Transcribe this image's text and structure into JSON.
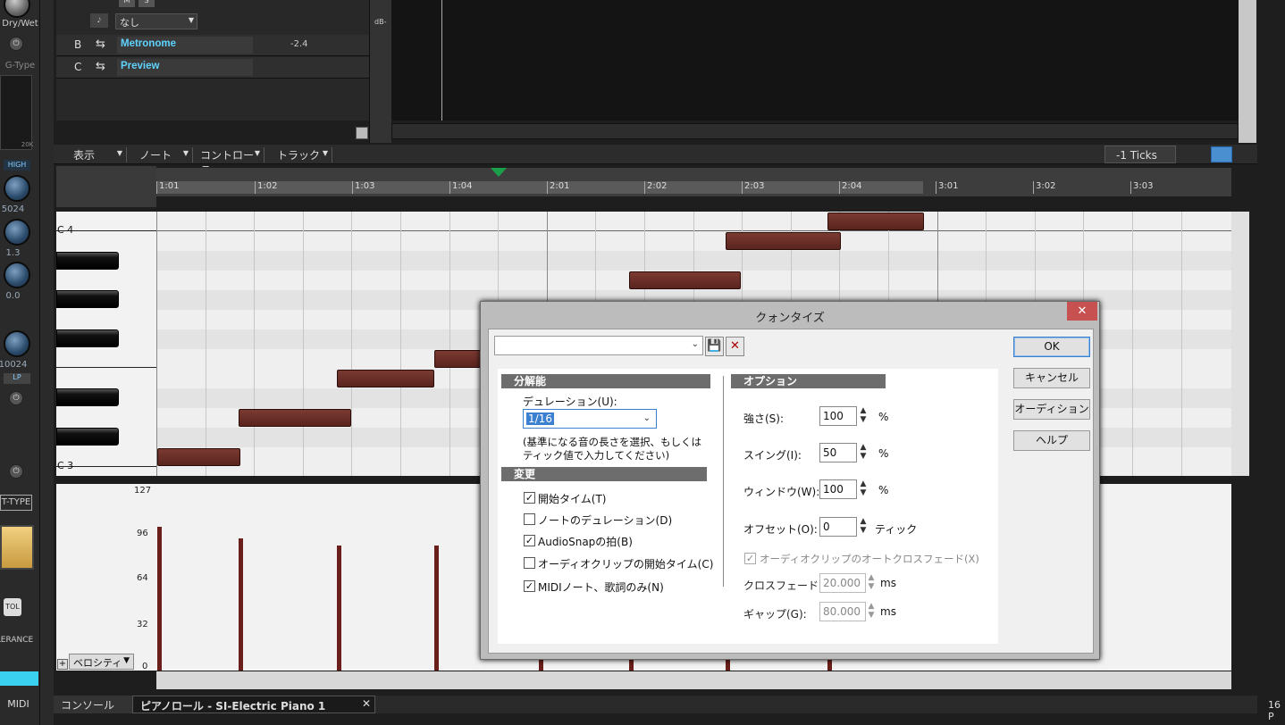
{
  "left_strip": {
    "drywet": "Dry/Wet",
    "gtype": "G-Type",
    "k20": "20K",
    "high": "HIGH",
    "freq": "5024",
    "gain": "1.3",
    "q": "0.0",
    "freq2": "10024",
    "lp": "LP",
    "ttype": "T-TYPE",
    "tol": "TOL",
    "tolerance": "LERANCE",
    "midi": "MIDI"
  },
  "tracks": {
    "none_label": "なし",
    "db_label": "dB-",
    "rows": [
      {
        "letter": "B",
        "name": "Metronome",
        "value": "-2.4"
      },
      {
        "letter": "C",
        "name": "Preview",
        "value": ""
      }
    ]
  },
  "menubar": {
    "view": "表示",
    "note": "ノート",
    "controller": "コントローラ",
    "track": "トラック",
    "ticks": "-1 Ticks"
  },
  "ruler": {
    "ticks": [
      "1:01",
      "1:02",
      "1:03",
      "1:04",
      "2:01",
      "2:02",
      "2:03",
      "2:04",
      "3:01",
      "3:02",
      "3:03"
    ]
  },
  "piano": {
    "c4": "C 4",
    "c3": "C 3"
  },
  "velocity": {
    "labels": [
      "127",
      "96",
      "64",
      "32",
      "0"
    ],
    "dropdown": "ベロシティ"
  },
  "tabs": {
    "console": "コンソール",
    "pianoroll": "ピアノロール - SI-Electric Piano 1",
    "right_num": "16 P"
  },
  "dialog": {
    "title": "クォンタイズ",
    "preset_value": "",
    "resolution_header": "分解能",
    "duration_label": "デュレーション(U):",
    "duration_value": "1/16",
    "duration_help1": "(基準になる音の長さを選択、もしくは",
    "duration_help2": "ティック値で入力してください)",
    "change_header": "変更",
    "checks": [
      {
        "label": "開始タイム(T)",
        "checked": true
      },
      {
        "label": "ノートのデュレーション(D)",
        "checked": false
      },
      {
        "label": "AudioSnapの拍(B)",
        "checked": true
      },
      {
        "label": "オーディオクリップの開始タイム(C)",
        "checked": false
      },
      {
        "label": "MIDIノート、歌詞のみ(N)",
        "checked": true
      }
    ],
    "options_header": "オプション",
    "strength_label": "強さ(S):",
    "strength_value": "100",
    "strength_unit": "%",
    "swing_label": "スイング(I):",
    "swing_value": "50",
    "swing_unit": "%",
    "window_label": "ウィンドウ(W):",
    "window_value": "100",
    "window_unit": "%",
    "offset_label": "オフセット(O):",
    "offset_value": "0",
    "offset_unit": "ティック",
    "autocross_label": "オーディオクリップのオートクロスフェード(X)",
    "autocross_checked": true,
    "crossfade_label": "クロスフェード(F):",
    "crossfade_value": "20.000",
    "crossfade_unit": "ms",
    "gap_label": "ギャップ(G):",
    "gap_value": "80.000",
    "gap_unit": "ms",
    "ok": "OK",
    "cancel": "キャンセル",
    "audition": "オーディション",
    "help": "ヘルプ"
  }
}
